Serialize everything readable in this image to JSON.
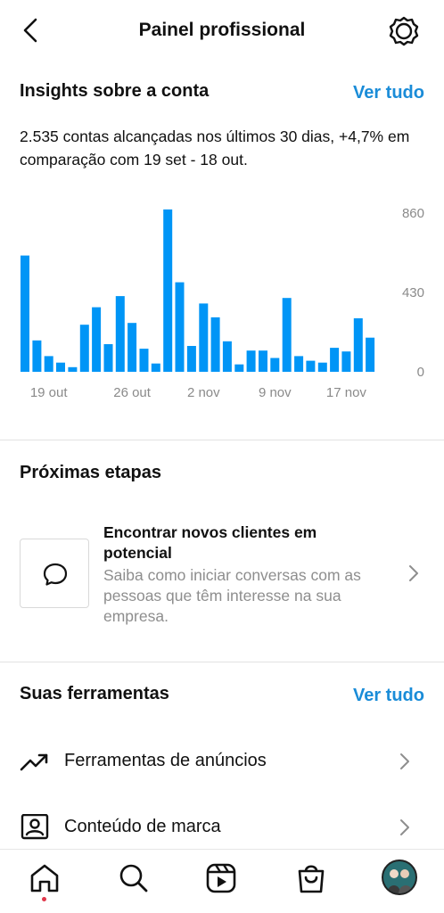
{
  "header": {
    "title": "Painel profissional",
    "back_icon": "back-arrow-icon",
    "settings_icon": "gear-icon"
  },
  "insights": {
    "heading": "Insights sobre a conta",
    "link": "Ver tudo",
    "summary": "2.535 contas alcançadas nos últimos 30 dias, +4,7% em comparação com 19 set - 18 out.",
    "accent": "#0095f6"
  },
  "chart_data": {
    "type": "bar",
    "values": [
      630,
      170,
      85,
      50,
      25,
      255,
      350,
      150,
      410,
      265,
      125,
      45,
      880,
      485,
      140,
      370,
      295,
      165,
      40,
      115,
      115,
      75,
      400,
      85,
      60,
      50,
      130,
      110,
      290,
      185
    ],
    "x_tick_labels": [
      "19 out",
      "26 out",
      "2 nov",
      "9 nov",
      "17 nov"
    ],
    "x_tick_positions": [
      2,
      9,
      15,
      21,
      27
    ],
    "y_tick_labels": [
      "860",
      "430",
      "0"
    ],
    "y_tick_values": [
      860,
      430,
      0
    ],
    "ylim": [
      0,
      860
    ],
    "bar_color": "#0095f6",
    "grid": false
  },
  "next_steps": {
    "heading": "Próximas etapas",
    "item": {
      "title": "Encontrar novos clientes em potencial",
      "description": "Saiba como iniciar conversas com as pessoas que têm interesse na sua empresa.",
      "icon": "chat-bubble-icon"
    }
  },
  "tools": {
    "heading": "Suas ferramentas",
    "link": "Ver tudo",
    "items": [
      {
        "label": "Ferramentas de anúncios",
        "icon": "trending-up-icon"
      },
      {
        "label": "Conteúdo de marca",
        "icon": "branded-content-icon"
      }
    ]
  },
  "nav": {
    "items": [
      "home-icon",
      "search-icon",
      "reels-icon",
      "shop-icon",
      "profile-avatar"
    ],
    "notification_dot_color": "#e0364a"
  }
}
